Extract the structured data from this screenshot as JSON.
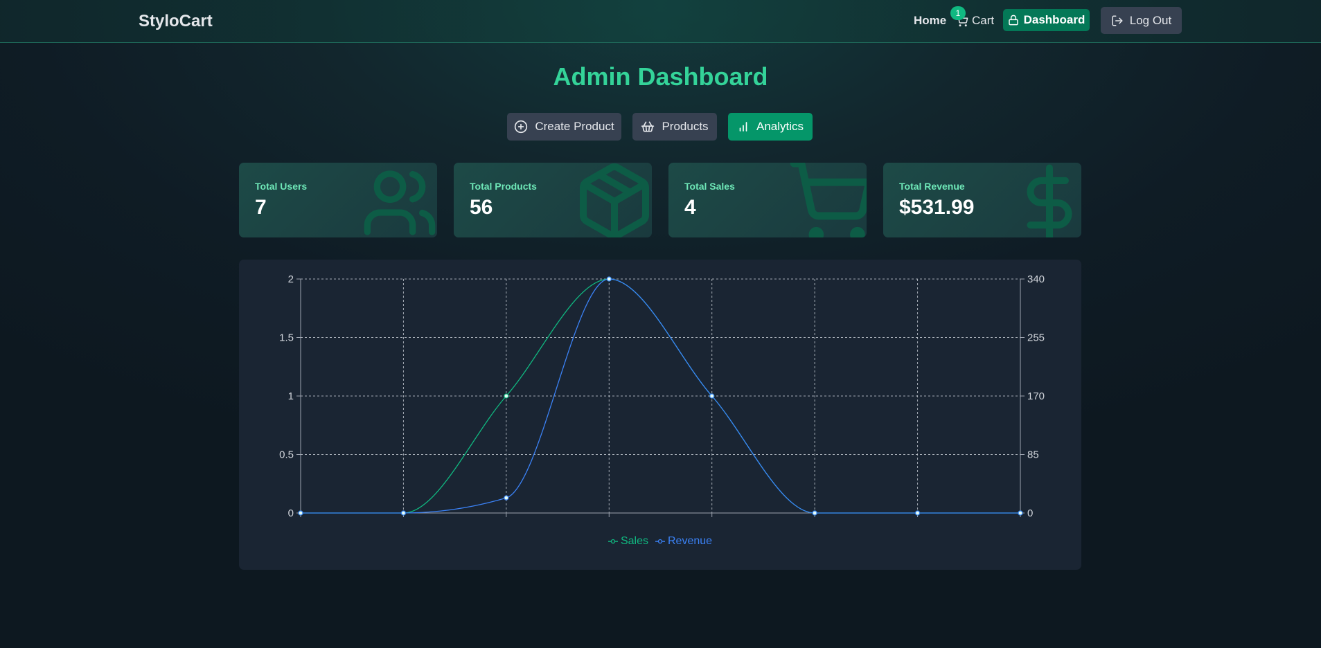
{
  "header": {
    "brand": "StyloCart",
    "home_label": "Home",
    "cart_label": "Cart",
    "cart_count": "1",
    "dashboard_label": "Dashboard",
    "logout_label": "Log Out"
  },
  "main": {
    "title": "Admin Dashboard",
    "tabs": [
      {
        "label": "Create Product",
        "icon": "plus-circle-icon",
        "active": false
      },
      {
        "label": "Products",
        "icon": "basket-icon",
        "active": false
      },
      {
        "label": "Analytics",
        "icon": "bar-chart-icon",
        "active": true
      }
    ],
    "stats": [
      {
        "label": "Total Users",
        "value": "7",
        "icon": "users-icon"
      },
      {
        "label": "Total Products",
        "value": "56",
        "icon": "package-icon"
      },
      {
        "label": "Total Sales",
        "value": "4",
        "icon": "shopping-cart-icon"
      },
      {
        "label": "Total Revenue",
        "value": "$531.99",
        "icon": "dollar-sign-icon"
      }
    ]
  },
  "colors": {
    "accent": "#34d399",
    "sales": "#10b981",
    "revenue": "#3b82f6",
    "active_tab": "#059669",
    "dashboard_button": "#047857"
  },
  "chart_data": {
    "type": "line",
    "x": [
      0,
      1,
      2,
      3,
      4,
      5,
      6,
      7
    ],
    "series": [
      {
        "name": "Sales",
        "axis": "left",
        "values": [
          0,
          0,
          1,
          2,
          1,
          0,
          0,
          0
        ]
      },
      {
        "name": "Revenue",
        "axis": "right",
        "values": [
          0,
          0,
          22,
          340,
          170,
          0,
          0,
          0
        ]
      }
    ],
    "left_axis": {
      "ylim": [
        0,
        2
      ],
      "ticks": [
        "0",
        "0.5",
        "1",
        "1.5",
        "2"
      ]
    },
    "right_axis": {
      "ylim": [
        0,
        340
      ],
      "ticks": [
        "0",
        "85",
        "170",
        "255",
        "340"
      ]
    },
    "grid": true,
    "legend_position": "bottom-center",
    "curve": "monotone"
  }
}
